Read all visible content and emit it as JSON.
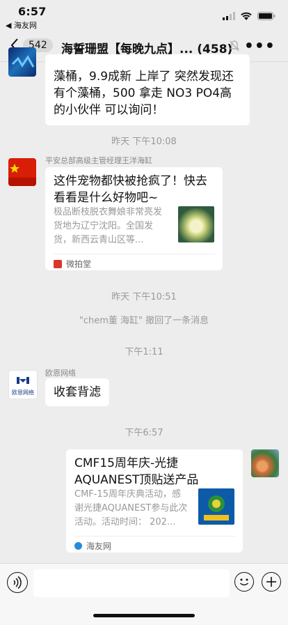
{
  "status": {
    "time": "6:57",
    "back_app": "◀ 海友网"
  },
  "nav": {
    "unread_count": "542",
    "title": "海誓珊盟【每晚九点】... (458)"
  },
  "messages": {
    "m1": {
      "text": "藻桶，9.9成新 上岸了 突然发现还有个藻桶，500 拿走 NO3 PO4高的小伙伴 可以询问！"
    },
    "ts1": "昨天 下午10:08",
    "m2": {
      "sender": "平安总部高级主管经理王洋海缸",
      "title": "这件宠物都快被抢疯了！快去看看是什么好物吧~",
      "desc": "极品断枝脱衣舞娘非常亮发货地为辽宁沈阳。全国发货，新西云青山区等...",
      "source": "微拍堂"
    },
    "ts2": "昨天 下午10:51",
    "recall": "\"chem董 海缸\" 撤回了一条消息",
    "ts3": "下午1:11",
    "m3": {
      "sender": "欧恩网络",
      "text": "收套背滤",
      "avatar_text": "欧恩网络"
    },
    "ts4": "下午6:57",
    "m4": {
      "title": "CMF15周年庆-光捷AQUANEST顶贴送产品",
      "desc": "CMF-15周年庆典活动，感谢光捷AQUANEST参与此次活动。活动时间： 202...",
      "source": "海友网"
    }
  },
  "input": {
    "placeholder": ""
  },
  "colors": {
    "background": "#ededed",
    "bubble": "#ffffff",
    "meta_text": "#999999"
  }
}
